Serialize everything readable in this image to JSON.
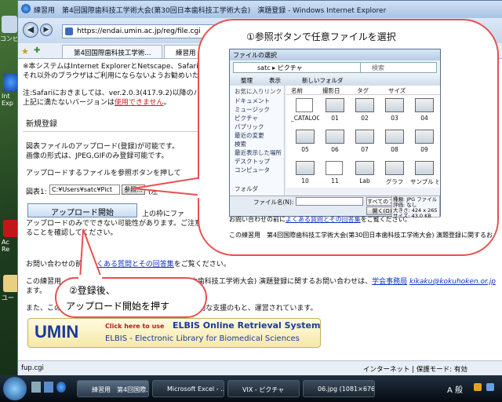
{
  "desktop": {
    "icons": [
      {
        "label": "コンピ"
      },
      {
        "label": "Int\nExp"
      },
      {
        "label": "Ac\nRe"
      },
      {
        "label": "ユー"
      }
    ]
  },
  "browser": {
    "title": "練習用　第4回国際歯科技工学術大会(第30回日本歯科技工学術大会)　演題登録 - Windows Internet Explorer",
    "url": "https://endai.umin.ac.jp/reg/file.cgi",
    "tabs": [
      "第4回国際歯科技工学術...",
      "練習用　第4回国..."
    ],
    "content": {
      "warn1": "※本システムはInternet ExplorerとNetscape、Safariで動作確認を",
      "warn2": "それ以外のブラウザはご利用にならないようお勧めいたします。",
      "safari1": "注:Safariにおきましては、ver.2.0.3(417.9.2)以降のバージョンでご",
      "safari2a": "上記に満たないバージョンは",
      "safari2b": "使用できません",
      "safari2c": "。",
      "heading": "新規登録",
      "p1": "図表ファイルのアップロード(登録)が可能です。",
      "p2": "画像の形式は、JPEG,GIFのみ登録可能です。",
      "p3": "アップロードするファイルを参照ボタンを押して",
      "field_label": "図表1:",
      "file_value": "C:¥Users¥satc¥Pict",
      "browse_label": "参照...",
      "after_browse": "(左",
      "upload_label": "アップロード開始",
      "upload_right": "上の枠にファ",
      "note1": "アップロードのみでできない可能性があります。ご注意",
      "note2": "ることを確認してください。",
      "inq_a": "お問い合わせの前に",
      "inq_link": "よくある質問とその回答集",
      "inq_b": "をご覧ください。",
      "contact1": "この練習用　第4回国際歯科技工学術大会(第30回日本歯科技工学術大会) 演題登録に関するお問い合わせは、",
      "contact_link": "学会事務局",
      "contact_email": "kikaku@kokuhoken.or.jp",
      "contact2": "ます。",
      "support": "また、このシステムは、　　　　　　　　　　　　全面的な支援のもと、運営されています。",
      "right_cut1": "よ",
      "right_cut2": "みすること",
      "right_cut3": "を選びま",
      "right_cut4": "なお、フ",
      "right_cut5": "のアップ",
      "banner_umin": "UMIN",
      "banner_click": "Click here to use",
      "banner_title": "ELBIS Online Retrieval System",
      "banner_sub": "ELBIS - Electronic Library for Biomedical Sciences"
    },
    "status_left": "fup.cgi",
    "status_zone": "インターネット | 保護モード: 有効"
  },
  "callout1": "①参照ボタンで任意ファイルを選択",
  "callout2_line1": "②登録後、",
  "callout2_line2": "アップロード開始を押す",
  "dialog": {
    "title": "ファイルの選択",
    "path": [
      "satc",
      "ピクチャ"
    ],
    "search_placeholder": "検索",
    "toolbar": [
      "整理",
      "表示",
      "新しいフォルダ"
    ],
    "col_headers": [
      "名前",
      "撮影日",
      "タグ",
      "サイズ"
    ],
    "favorites_header": "お気に入りリンク",
    "tree": [
      "ドキュメント",
      "ミュージック",
      "ピクチャ",
      "パブリック",
      "最近の変更",
      "検索",
      "最近表示した場所",
      "デスクトップ",
      "コンピュータ"
    ],
    "folder_label": "フォルダ",
    "files": [
      "_CATALOG.VIX",
      "01",
      "02",
      "03",
      "04",
      "05",
      "06",
      "07",
      "08",
      "09",
      "10",
      "11",
      "Lab",
      "グラフ",
      "サンプル ピ"
    ],
    "filename_label": "ファイル名(N):",
    "filetype": "すべてのファイル",
    "open_label": "開く(O)",
    "info": [
      "種類: JPG ファイル",
      "評価: なし",
      "大きさ: 424 x 265",
      "サイズ: 43.0 KB"
    ]
  },
  "bubble_bg": {
    "row1": "お問い合わせの前に",
    "row1_link": "よくある質問とその回答集",
    "row1_b": "をご覧ください。",
    "row2": "この練習用　第4回国際歯科技工学術大会(第30回日本歯科技工学術大会) 演題登録に関するお問"
  },
  "taskbar": {
    "items": [
      "練習用　第4回国際...",
      "Microsoft Excel - ...",
      "VIX - ピクチャ",
      "06.jpg (1081×676..."
    ],
    "tray": "A 般"
  },
  "colors": {
    "accent": "#e85050",
    "link": "#1030c0",
    "warning": "#d02020"
  }
}
